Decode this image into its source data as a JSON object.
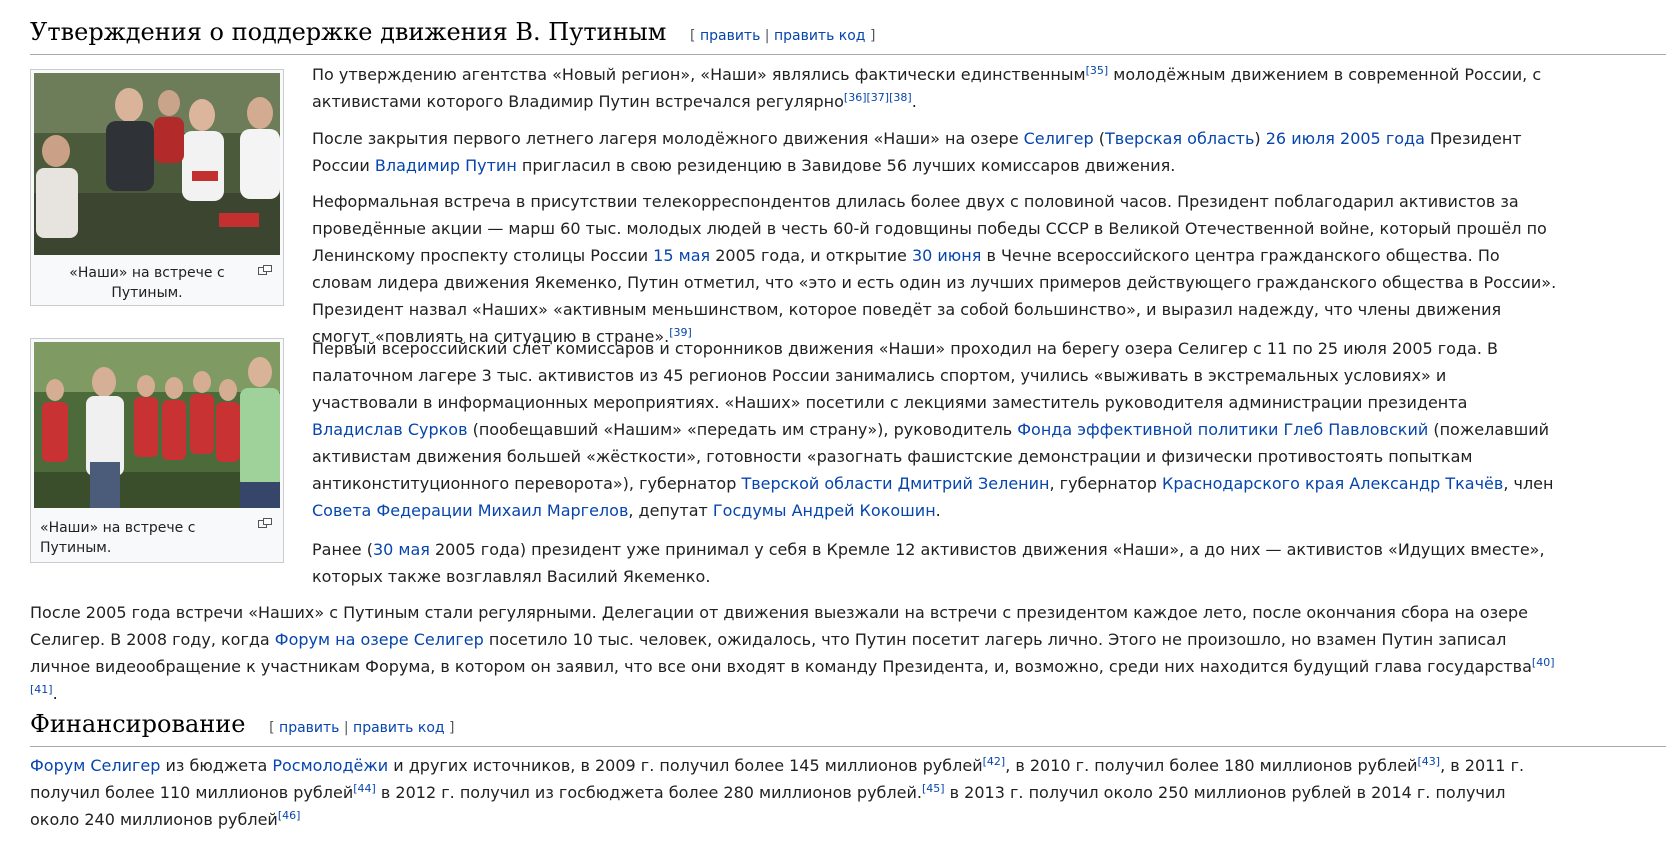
{
  "section1": {
    "title": "Утверждения о поддержке движения В. Путиным",
    "edit_open": "[",
    "edit": "править",
    "sep": "|",
    "edit_code": "править код",
    "edit_close": "]"
  },
  "thumbs": [
    {
      "caption": "«Наши» на встрече с Путиным."
    },
    {
      "caption": "«Наши» на встрече с Путиным."
    }
  ],
  "p1": {
    "t1": "По утверждению агентства «Новый регион», «Наши» являлись фактически единственным",
    "r1": "[35]",
    "t2": " молодёжным движением в современной России, с активистами которого Владимир Путин встречался регулярно",
    "r2": "[36]",
    "r3": "[37]",
    "r4": "[38]",
    "t3": "."
  },
  "p2": {
    "t1": "После закрытия первого летнего лагеря молодёжного движения «Наши» на озере ",
    "l1": "Селигер",
    "t2": " (",
    "l2": "Тверская область",
    "t3": ") ",
    "l3": "26 июля",
    "t4": " ",
    "l4": "2005 года",
    "t5": " Президент России ",
    "l5": "Владимир Путин",
    "t6": " пригласил в свою резиденцию в Завидове 56 лучших комиссаров движения."
  },
  "p3": {
    "t1": "Неформальная встреча в присутствии телекорреспондентов длилась более двух с половиной часов. Президент поблагодарил активистов за проведённые акции — марш 60 тыс. молодых людей в честь 60-й годовщины победы СССР в Великой Отечественной войне, который прошёл по Ленинскому проспекту столицы России ",
    "l1": "15 мая",
    "t2": " 2005 года, и открытие ",
    "l2": "30 июня",
    "t3": " в Чечне всероссийского центра гражданского общества. По словам лидера движения Якеменко, Путин отметил, что «это и есть один из лучших примеров действующего гражданского общества в России». Президент назвал «Наших» «активным меньшинством, которое поведёт за собой большинство», и выразил надежду, что члены движения смогут «повлиять на ситуацию в стране».",
    "r1": "[39]"
  },
  "p4": {
    "t1": "Первый всероссийский слёт комиссаров и сторонников движения «Наши» проходил на берегу озера Селигер с 11 по 25 июля 2005 года. В палаточном лагере 3 тыс. активистов из 45 регионов России занимались спортом, учились «выживать в экстремальных условиях» и участвовали в информационных мероприятиях. «Наших» посетили с лекциями заместитель руководителя администрации президента ",
    "l1": "Владислав Сурков",
    "t2": " (пообещавший «Нашим» «передать им страну»), руководитель ",
    "l2": "Фонда эффективной политики",
    "t3": " ",
    "l3": "Глеб Павловский",
    "t4": " (пожелавший активистам движения большей «жёсткости», готовности «разогнать фашистские демонстрации и физически противостоять попыткам антиконституционного переворота»), губернатор ",
    "l4": "Тверской области",
    "t5": " ",
    "l5": "Дмитрий Зеленин",
    "t6": ", губернатор ",
    "l6": "Краснодарского края",
    "t7": " ",
    "l7": "Александр Ткачёв",
    "t8": ", член ",
    "l8": "Совета Федерации",
    "t9": " ",
    "l9": "Михаил Маргелов",
    "t10": ", депутат ",
    "l10": "Госдумы",
    "t11": " ",
    "l11": "Андрей Кокошин",
    "t12": "."
  },
  "p5": {
    "t1": "Ранее (",
    "l1": "30 мая",
    "t2": " 2005 года) президент уже принимал у себя в Кремле 12 активистов движения «Наши», а до них — активистов «Идущих вместе», которых также возглавлял Василий Якеменко."
  },
  "p6": {
    "t1": "После 2005 года встречи «Наших» с Путиным стали регулярными. Делегации от движения выезжали на встречи с президентом каждое лето, после окончания сбора на озере Селигер. В 2008 году, когда ",
    "l1": "Форум на озере Селигер",
    "t2": " посетило 10 тыс. человек, ожидалось, что Путин посетит лагерь лично. Этого не произошло, но взамен Путин записал личное видеообращение к участникам Форума, в котором он заявил, что все они входят в команду Президента, и, возможно, среди них находится будущий глава государства",
    "r1": "[40]",
    "r2": "[41]",
    "t3": "."
  },
  "section2": {
    "title": "Финансирование",
    "edit_open": "[",
    "edit": "править",
    "sep": "|",
    "edit_code": "править код",
    "edit_close": "]"
  },
  "p7": {
    "l1": "Форум Селигер",
    "t1": " из бюджета ",
    "l2": "Росмолодёжи",
    "t2": " и других источников, в 2009 г. получил более 145 миллионов рублей",
    "r1": "[42]",
    "t3": ", в 2010 г. получил более 180 миллионов рублей",
    "r2": "[43]",
    "t4": ", в 2011 г. получил более 110 миллионов рублей",
    "r3": "[44]",
    "t5": " в 2012 г. получил из госбюджета более 280 миллионов рублей.",
    "r4": "[45]",
    "t6": " в 2013 г. получил около 250 миллионов рублей в 2014 г. получил около 240 миллионов рублей",
    "r5": "[46]"
  }
}
